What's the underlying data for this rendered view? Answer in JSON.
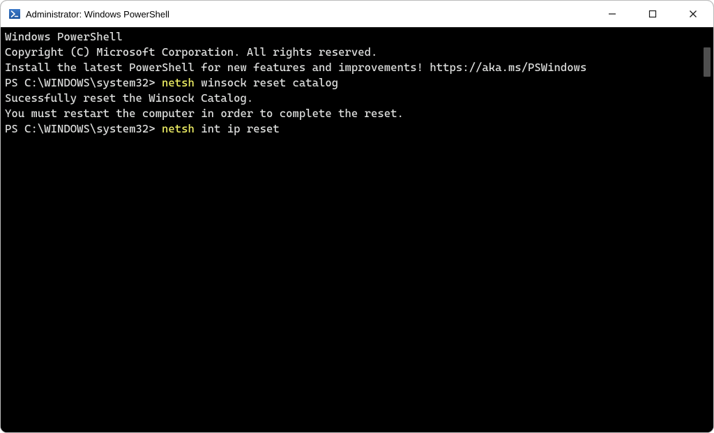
{
  "titlebar": {
    "title": "Administrator: Windows PowerShell"
  },
  "terminal": {
    "banner1": "Windows PowerShell",
    "banner2": "Copyright (C) Microsoft Corporation. All rights reserved.",
    "install_msg": "Install the latest PowerShell for new features and improvements! https://aka.ms/PSWindows",
    "prompt": "PS C:\\WINDOWS\\system32> ",
    "cmd1_head": "netsh",
    "cmd1_rest": " winsock reset catalog",
    "result1a": "Sucessfully reset the Winsock Catalog.",
    "result1b": "You must restart the computer in order to complete the reset.",
    "cmd2_head": "netsh",
    "cmd2_rest": " int ip reset"
  }
}
